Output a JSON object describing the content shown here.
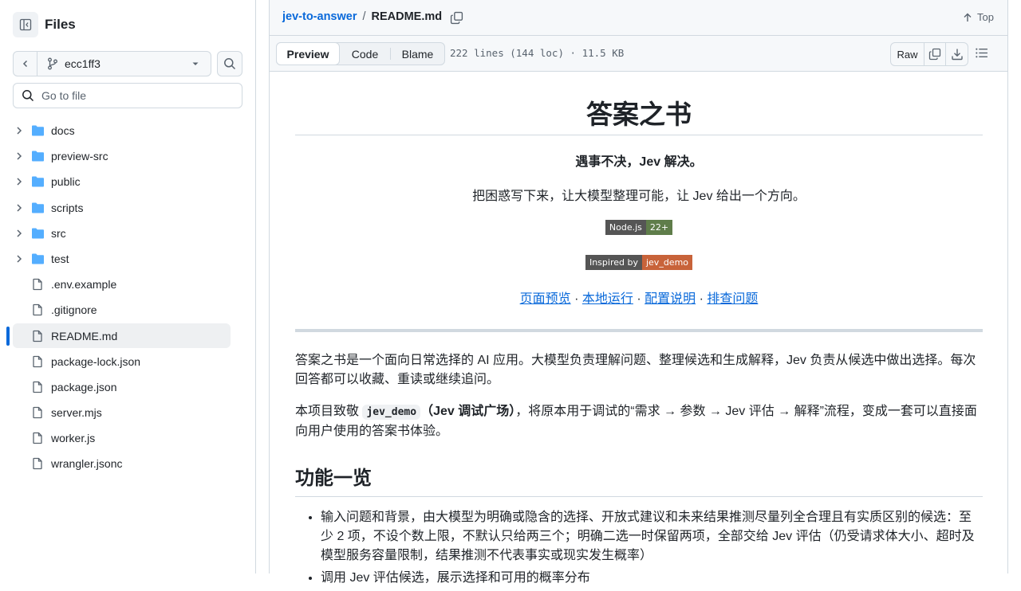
{
  "sidebar": {
    "title": "Files",
    "branch": "ecc1ff3",
    "goto_placeholder": "Go to file",
    "items": [
      {
        "name": "docs",
        "type": "folder"
      },
      {
        "name": "preview-src",
        "type": "folder"
      },
      {
        "name": "public",
        "type": "folder"
      },
      {
        "name": "scripts",
        "type": "folder"
      },
      {
        "name": "src",
        "type": "folder"
      },
      {
        "name": "test",
        "type": "folder"
      },
      {
        "name": ".env.example",
        "type": "file"
      },
      {
        "name": ".gitignore",
        "type": "file"
      },
      {
        "name": "README.md",
        "type": "file",
        "selected": true
      },
      {
        "name": "package-lock.json",
        "type": "file"
      },
      {
        "name": "package.json",
        "type": "file"
      },
      {
        "name": "server.mjs",
        "type": "file"
      },
      {
        "name": "worker.js",
        "type": "file"
      },
      {
        "name": "wrangler.jsonc",
        "type": "file"
      }
    ]
  },
  "header": {
    "repo": "jev-to-answer",
    "separator": "/",
    "file": "README.md",
    "top_label": "Top"
  },
  "toolbar": {
    "tabs": [
      "Preview",
      "Code",
      "Blame"
    ],
    "file_info": "222 lines (144 loc) · 11.5 KB",
    "raw_label": "Raw"
  },
  "readme": {
    "title": "答案之书",
    "tagline": "遇事不决，Jev 解决。",
    "subline": "把困惑写下来，让大模型整理可能，让 Jev 给出一个方向。",
    "badge1": {
      "left": "Node.js",
      "right": "22+",
      "color": "#5f7d4a"
    },
    "badge2": {
      "left": "Inspired by",
      "right": "jev_demo",
      "color": "#c8633a"
    },
    "links": [
      "页面预览",
      "本地运行",
      "配置说明",
      "排查问题"
    ],
    "link_sep": " · ",
    "para1": "答案之书是一个面向日常选择的 AI 应用。大模型负责理解问题、整理候选和生成解释，Jev 负责从候选中做出选择。每次回答都可以收藏、重读或继续追问。",
    "para2_before": "本项目致敬 ",
    "para2_code": "jev_demo",
    "para2_bold": "（Jev 调试广场）",
    "para2_after": "，将原本用于调试的“需求 → 参数 → Jev 评估 → 解释”流程，变成一套可以直接面向用户使用的答案书体验。",
    "section_title": "功能一览",
    "features": [
      "输入问题和背景，由大模型为明确或隐含的选择、开放式建议和未来结果推测尽量列全合理且有实质区别的候选：至少 2 项，不设个数上限，不默认只给两三个；明确二选一时保留两项，全部交给 Jev 评估（仍受请求体大小、超时及模型服务容量限制，结果推测不代表事实或现实发生概率）",
      "调用 Jev 评估候选，展示选择和可用的概率分布"
    ]
  }
}
